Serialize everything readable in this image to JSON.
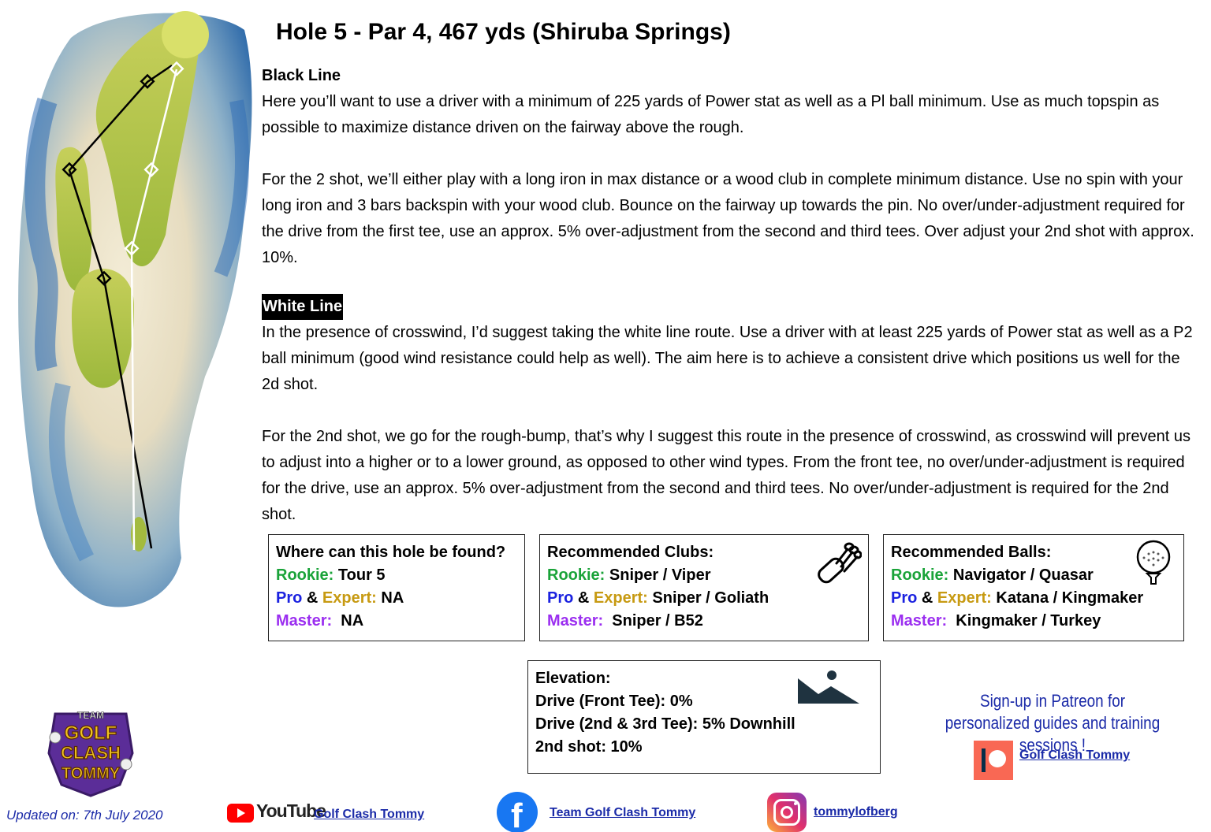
{
  "title": "Hole 5 - Par 4, 467 yds (Shiruba Springs)",
  "black_line": {
    "heading": "Black Line",
    "paragraph1": "Here you’ll want to use a driver with a minimum of 225 yards of Power stat as well as a Pl ball minimum. Use as much topspin as possible to maximize distance driven on the fairway above the rough.",
    "paragraph2": "For the 2 shot, we’ll either play with a long iron in max distance or a wood club in complete minimum distance. Use no spin with your long iron and 3 bars backspin with your wood club. Bounce on the fairway up towards the pin. No over/under-adjustment required for the drive from the first tee, use an approx. 5% over-adjustment from the second and third tees. Over adjust your 2nd shot with approx. 10%."
  },
  "white_line": {
    "heading": "White Line",
    "paragraph1": "In the presence of crosswind, I’d suggest taking the white line route. Use a driver with at least 225 yards of Power stat as well as a P2 ball minimum (good wind resistance could help as well). The aim here is to achieve a consistent drive which positions us well for the 2d shot.",
    "paragraph2": "For the 2nd shot, we go for the rough-bump, that’s why I suggest this route in the presence of crosswind, as crosswind will prevent us to adjust into a higher or to a lower ground, as opposed to other wind types. From the front tee, no over/under-adjustment is required for the drive, use an approx. 5% over-adjustment from the second and third tees. No over/under-adjustment is required for the 2nd shot."
  },
  "labels": {
    "rookie": "Rookie:",
    "pro": "Pro",
    "amp": "&",
    "expert": "Expert:",
    "master": "Master:"
  },
  "location_box": {
    "heading": "Where can this hole be found?",
    "rookie": "Tour 5",
    "pro_expert": "NA",
    "master": "NA"
  },
  "clubs_box": {
    "heading": "Recommended Clubs:",
    "rookie": "Sniper / Viper",
    "pro_expert": "Sniper / Goliath",
    "master": "Sniper / B52",
    "icon": "golf-bag-icon"
  },
  "balls_box": {
    "heading": "Recommended Balls:",
    "rookie": "Navigator / Quasar",
    "pro_expert": "Katana / Kingmaker",
    "master": "Kingmaker / Turkey",
    "icon": "golf-ball-tee-icon"
  },
  "elevation_box": {
    "heading": "Elevation:",
    "line1": "Drive (Front Tee): 0%",
    "line2": "Drive (2nd & 3rd Tee): 5% Downhill",
    "line3": "2nd shot: 10%",
    "icon": "mountain-icon"
  },
  "logo": {
    "line1": "TEAM",
    "line2": "GOLF",
    "line3": "CLASH",
    "line4": "TOMMY"
  },
  "patreon": {
    "text": "Sign-up in Patreon for personalized guides and training sessions !",
    "link": "Golf Clash Tommy"
  },
  "footer": {
    "updated": "Updated on: 7th July 2020",
    "youtube_wordmark": "YouTube",
    "youtube_link": "Golf Clash Tommy",
    "facebook_link": "Team Golf Clash Tommy",
    "instagram_link": "tommylofberg"
  },
  "colors": {
    "rookie": "#1aa339",
    "pro": "#1b22e0",
    "expert": "#c79a12",
    "master": "#9b2ef0",
    "link": "#1b2ba8",
    "fairway": "#a9c143",
    "water": "#2f6fb0"
  }
}
